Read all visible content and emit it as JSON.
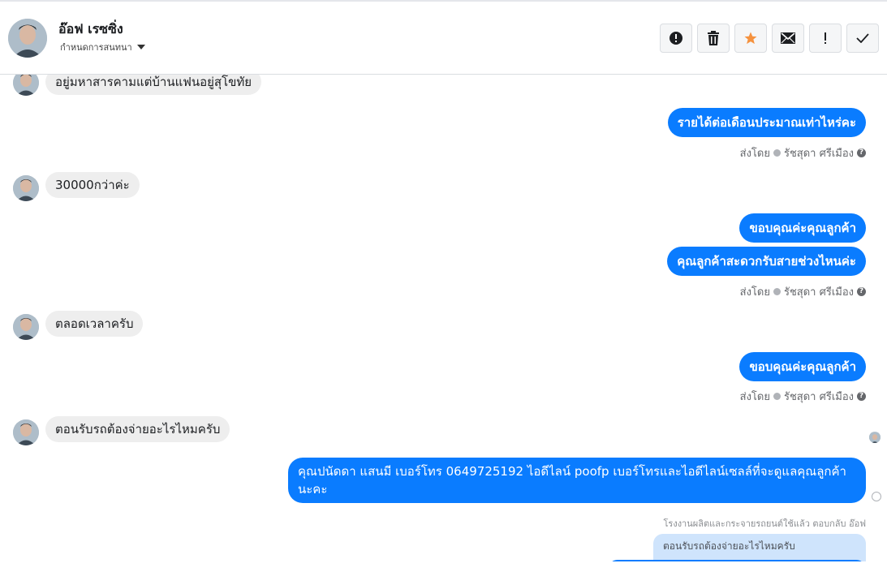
{
  "header": {
    "name": "อ๊อฟ เรซซิ่ง",
    "subtitle": "กำหนดการสนทนา",
    "avatar_icon": "person-photo",
    "tools": [
      {
        "name": "alert-icon",
        "glyph": "!"
      },
      {
        "name": "trash-icon",
        "glyph": "trash"
      },
      {
        "name": "star-icon",
        "glyph": "★",
        "color": "#f5923e"
      },
      {
        "name": "mail-icon",
        "glyph": "mail"
      },
      {
        "name": "exclamation-icon",
        "glyph": "!"
      },
      {
        "name": "checkmark-icon",
        "glyph": "✓"
      }
    ]
  },
  "messages": [
    {
      "dir": "in",
      "text": "อยู่มหาสารคามแต่บ้านแฟนอยู่สุโขทัย"
    },
    {
      "dir": "out",
      "text": "รายได้ต่อเดือนประมาณเท่าไหร่คะ"
    },
    {
      "dir": "in",
      "text": "30000กว่าค่ะ"
    },
    {
      "dir": "out",
      "text": "ขอบคุณค่ะคุณลูกค้า"
    },
    {
      "dir": "out",
      "text": "คุณลูกค้าสะดวกรับสายช่วงไหนค่ะ"
    },
    {
      "dir": "in",
      "text": "ตลอดเวลาครับ"
    },
    {
      "dir": "out",
      "text": "ขอบคุณค่ะคุณลูกค้า"
    },
    {
      "dir": "in",
      "text": "ตอนรับรถต้องจ่ายอะไรไหมครับ"
    },
    {
      "dir": "out",
      "text": "คุณปนัดดา แสนมี   เบอร์โทร 0649725192  ไอดีไลน์ poofp   เบอร์โทรและไอดีไลน์เซลล์ที่จะดูแลคุณลูกค้านะคะ"
    }
  ],
  "sent_by": {
    "prefix": "ส่งโดย",
    "agent": "รัชสุดา ศรีเมือง"
  },
  "reply": {
    "note": "โรงงานผลิตและกระจายรถยนต์ใช้แล้ว ตอบกลับ อ๊อฟ",
    "quoted": "ตอนรับรถต้องจ่ายอะไรไหมครับ"
  },
  "colors": {
    "outgoing": "#0a7cff",
    "incoming": "#eeeeee",
    "star": "#f5923e"
  }
}
